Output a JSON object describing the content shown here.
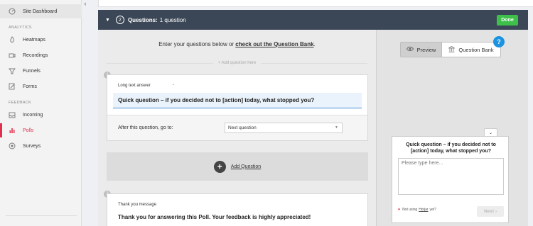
{
  "sidebar": {
    "collapse_icon": "chevron-left-icon",
    "top_item": {
      "label": "Site Dashboard",
      "icon": "speedometer-icon"
    },
    "section_analytics": "ANALYTICS",
    "analytics_items": [
      {
        "label": "Heatmaps",
        "icon": "flame-icon"
      },
      {
        "label": "Recordings",
        "icon": "camera-icon"
      },
      {
        "label": "Funnels",
        "icon": "funnel-icon"
      },
      {
        "label": "Forms",
        "icon": "pencil-icon"
      }
    ],
    "section_feedback": "FEEDBACK",
    "feedback_items": [
      {
        "label": "Incoming",
        "icon": "inbox-icon"
      },
      {
        "label": "Polls",
        "icon": "chart-icon",
        "active": true
      },
      {
        "label": "Surveys",
        "icon": "survey-icon"
      }
    ]
  },
  "header": {
    "step_number": "2",
    "title": "Questions:",
    "count": "1 question",
    "done_label": "Done"
  },
  "editor": {
    "intro_text": "Enter your questions below or ",
    "intro_link": "check out the Question Bank",
    "intro_end": ".",
    "add_here": "+ Add question here",
    "question": {
      "number": "1",
      "type_label": "Long text answer",
      "type_dash": "-",
      "text": "Quick question – if you decided not to [action] today, what stopped you?",
      "after_label": "After this question, go to:",
      "after_value": "Next question"
    },
    "add_question_label": "Add Question",
    "thankyou": {
      "number": "2",
      "type_label": "Thank you message",
      "text": "Thank you for answering this Poll. Your feedback is highly appreciated!"
    }
  },
  "preview": {
    "preview_label": "Preview",
    "bank_label": "Question Bank",
    "help_label": "?",
    "widget_question": "Quick question – if you decided not to [action] today, what stopped you?",
    "widget_placeholder": "Please type here...",
    "footer_prefix": "Not using",
    "footer_link": "Hotjar",
    "footer_suffix": "yet?",
    "next_label": "Next",
    "next_arrow": "›",
    "collapse_glyph": "⌄"
  },
  "colors": {
    "header_bg": "#3b4756",
    "done_green": "#3dbf4a",
    "active_red": "#e0304d",
    "help_blue": "#1b93e0"
  }
}
